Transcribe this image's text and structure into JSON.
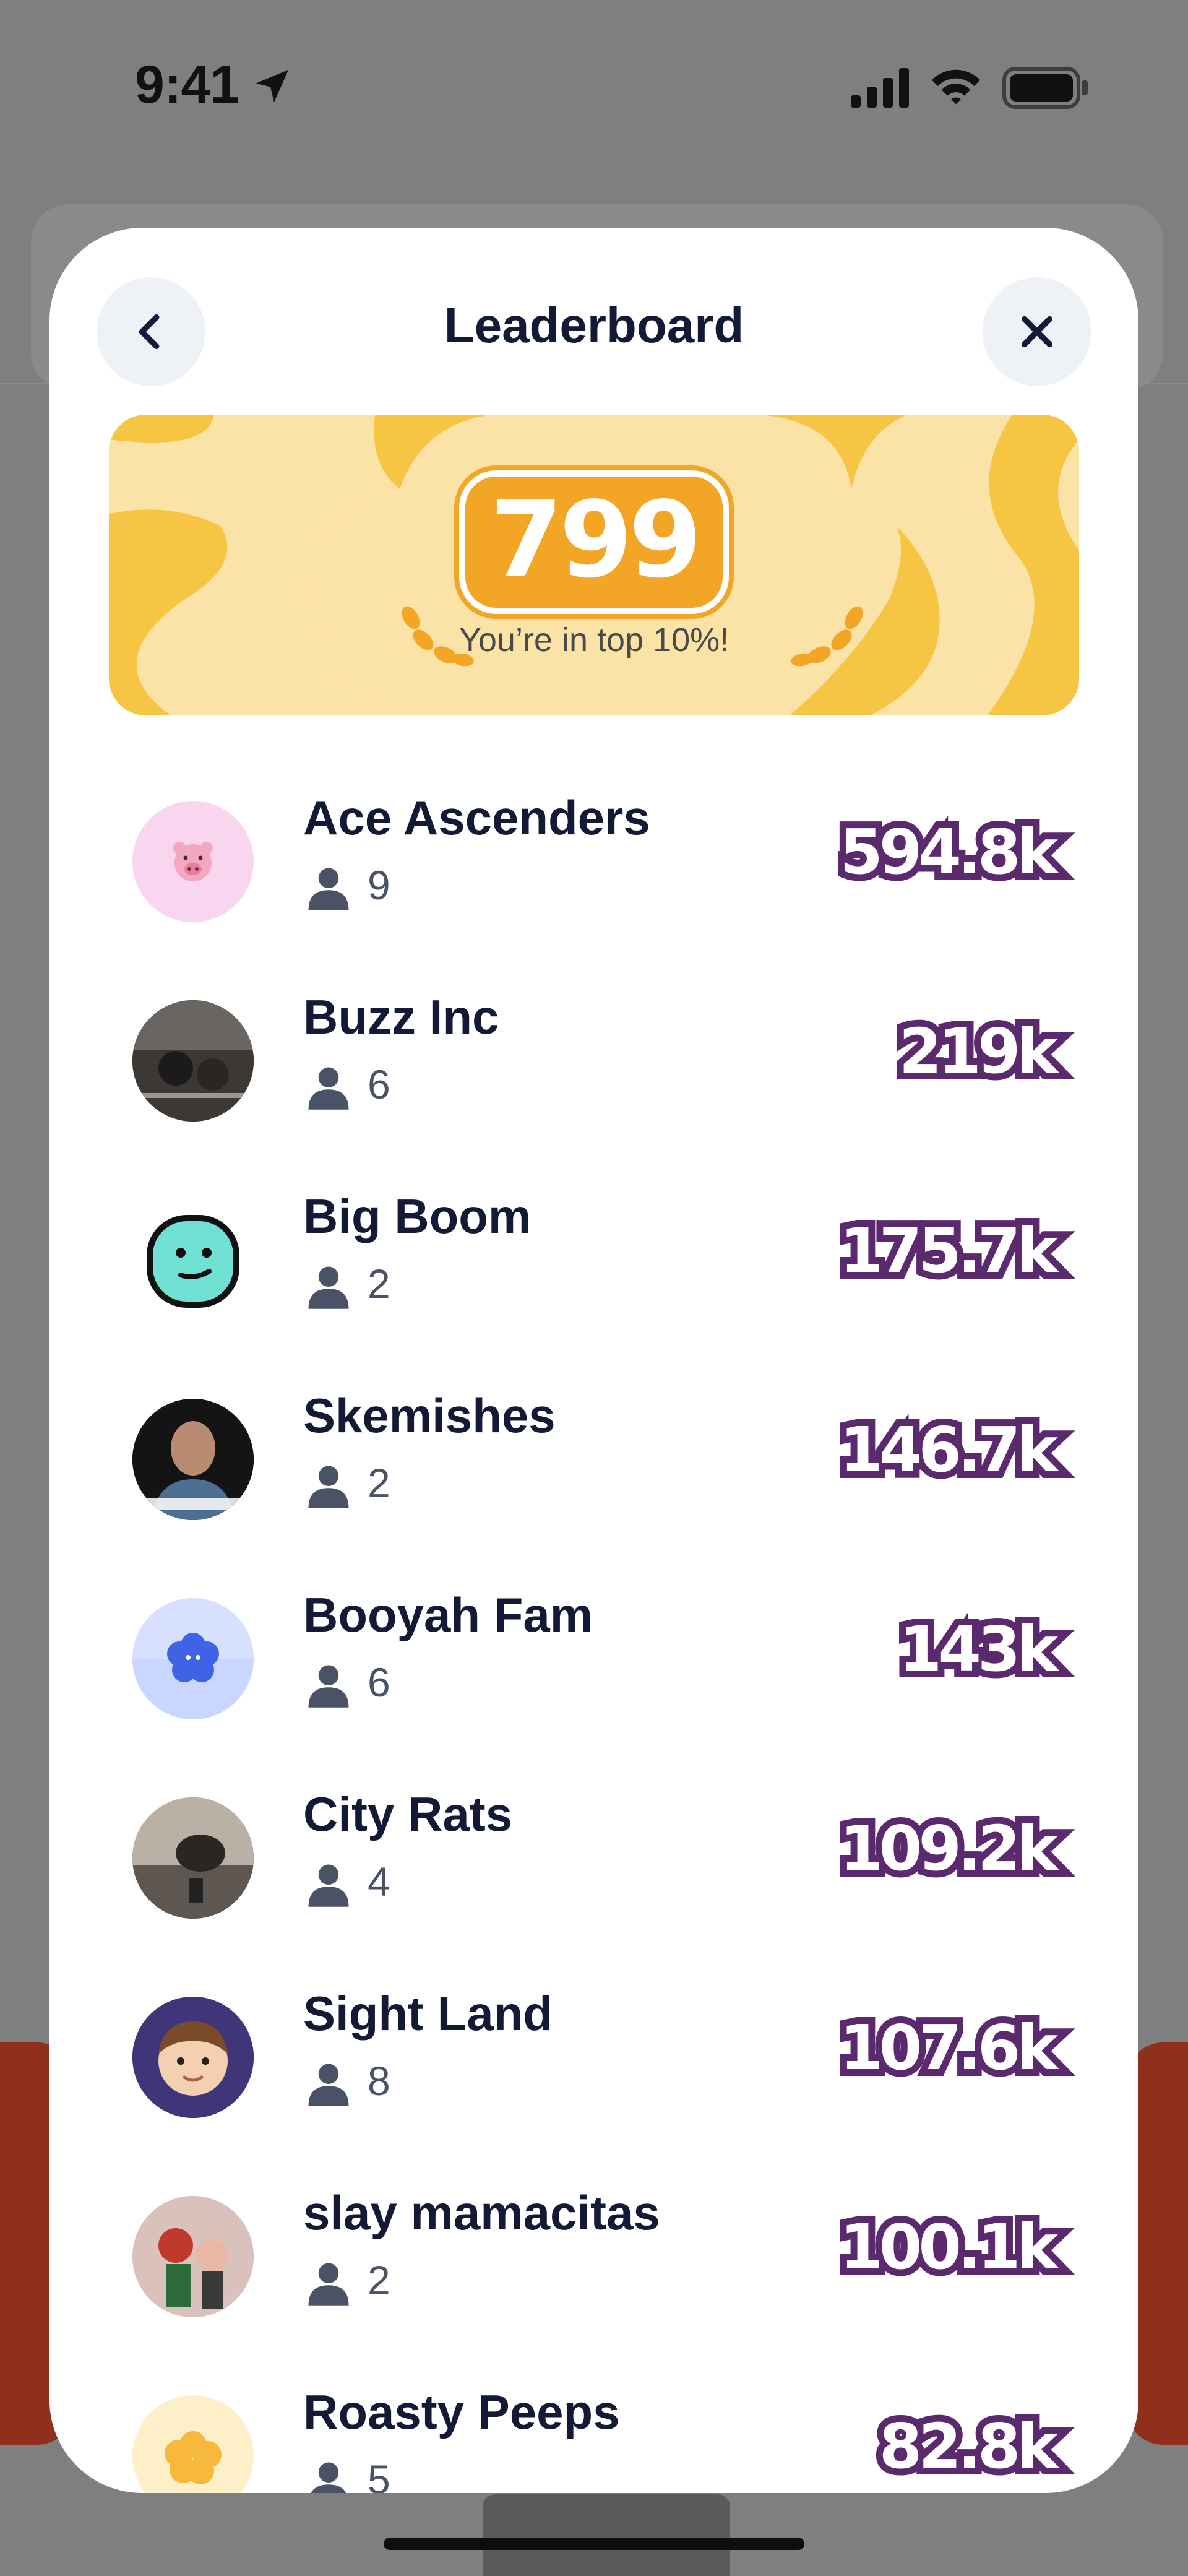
{
  "status_bar": {
    "time": "9:41",
    "icons": [
      "location-arrow-icon",
      "cellular-signal-icon",
      "wifi-icon",
      "battery-icon"
    ]
  },
  "header": {
    "title": "Leaderboard",
    "back_icon": "chevron-left-icon",
    "close_icon": "close-icon"
  },
  "banner": {
    "score": "799",
    "subtitle": "You’re in top 10%!",
    "colors": {
      "bg": "#f7c544",
      "light": "#fbe3a8",
      "badge": "#f3a526"
    }
  },
  "leaderboard": [
    {
      "name": "Ace Ascenders",
      "members": "9",
      "points": "594.8k",
      "avatar": "pig-emoji-avatar"
    },
    {
      "name": "Buzz Inc",
      "members": "6",
      "points": "219k",
      "avatar": "photo-avatar"
    },
    {
      "name": "Big Boom",
      "members": "2",
      "points": "175.7k",
      "avatar": "smiley-face-avatar"
    },
    {
      "name": "Skemishes",
      "members": "2",
      "points": "146.7k",
      "avatar": "photo-avatar"
    },
    {
      "name": "Booyah Fam",
      "members": "6",
      "points": "143k",
      "avatar": "flower-blob-avatar"
    },
    {
      "name": "City Rats",
      "members": "4",
      "points": "109.2k",
      "avatar": "photo-avatar"
    },
    {
      "name": "Sight Land",
      "members": "8",
      "points": "107.6k",
      "avatar": "cartoon-boy-avatar"
    },
    {
      "name": "slay mamacitas",
      "members": "2",
      "points": "100.1k",
      "avatar": "photo-avatar"
    },
    {
      "name": "Roasty Peeps",
      "members": "5",
      "points": "82.8k",
      "avatar": "yellow-blob-avatar"
    }
  ],
  "colors": {
    "points_outline": "#5b2a6e",
    "title": "#121a35"
  }
}
